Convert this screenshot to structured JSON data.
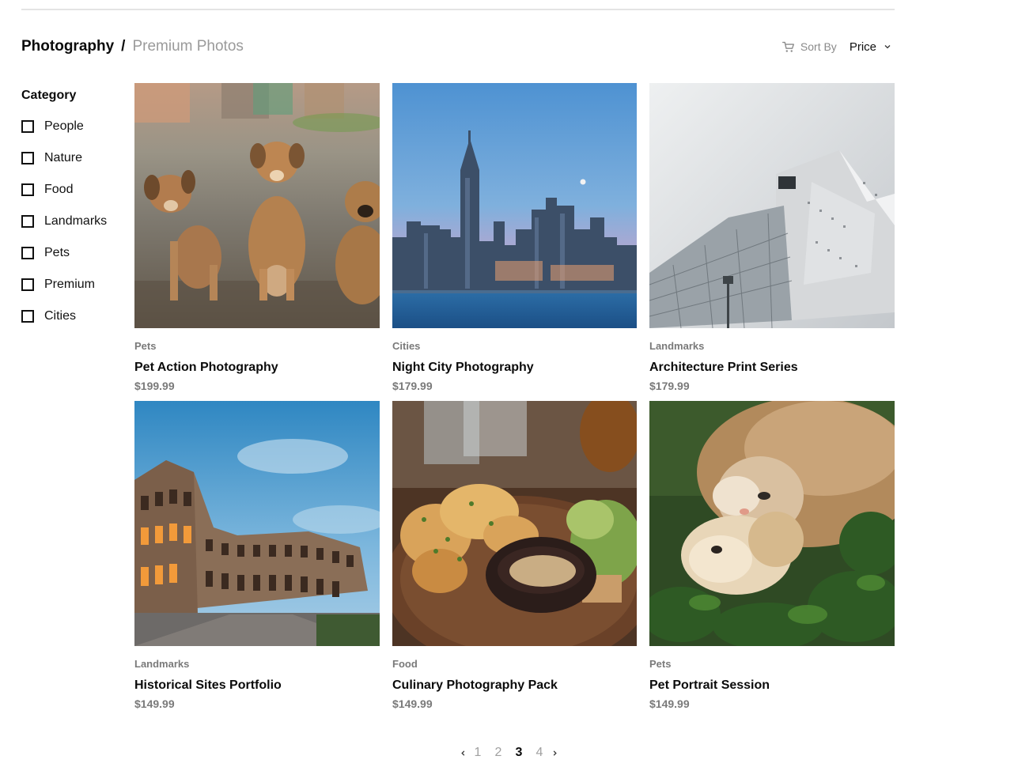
{
  "breadcrumb": {
    "root": "Photography",
    "separator": "/",
    "current": "Premium Photos"
  },
  "sort": {
    "icon": "cart-icon",
    "label": "Sort By",
    "value": "Price"
  },
  "sidebar": {
    "title": "Category",
    "filters": [
      {
        "label": "People",
        "checked": false
      },
      {
        "label": "Nature",
        "checked": false
      },
      {
        "label": "Food",
        "checked": false
      },
      {
        "label": "Landmarks",
        "checked": false
      },
      {
        "label": "Pets",
        "checked": false
      },
      {
        "label": "Premium",
        "checked": false
      },
      {
        "label": "Cities",
        "checked": false
      }
    ]
  },
  "products": [
    {
      "category": "Pets",
      "title": "Pet Action Photography",
      "price": "$199.99",
      "image": "three puppies on gravel"
    },
    {
      "category": "Cities",
      "title": "Night City Photography",
      "price": "$179.99",
      "image": "city skyline over water at dusk"
    },
    {
      "category": "Landmarks",
      "title": "Architecture Print Series",
      "price": "$179.99",
      "image": "modern angular white building"
    },
    {
      "category": "Landmarks",
      "title": "Historical Sites Portfolio",
      "price": "$149.99",
      "image": "colosseum at dusk"
    },
    {
      "category": "Food",
      "title": "Culinary Photography Pack",
      "price": "$149.99",
      "image": "plate of food with dip"
    },
    {
      "category": "Pets",
      "title": "Pet Portrait Session",
      "price": "$149.99",
      "image": "cat and dog lying in grass"
    }
  ],
  "pagination": {
    "pages": [
      "1",
      "2",
      "3",
      "4"
    ],
    "current": "3"
  },
  "colors": {
    "text": "#0b0b0b",
    "muted": "#7a7a7a",
    "divider": "#e4e4e4"
  }
}
